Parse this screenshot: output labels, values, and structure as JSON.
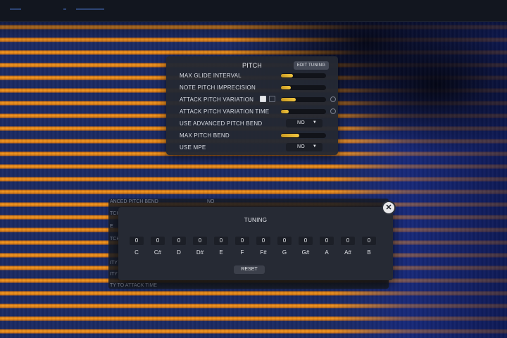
{
  "pitch_panel": {
    "title": "PITCH",
    "edit_tuning_label": "EDIT TUNING",
    "rows": [
      {
        "label": "MAX GLIDE INTERVAL",
        "type": "slider",
        "fill": 0.27
      },
      {
        "label": "NOTE PITCH IMPRECISION",
        "type": "slider",
        "fill": 0.22
      },
      {
        "label": "ATTACK PITCH VARIATION",
        "type": "slider",
        "fill": 0.33
      },
      {
        "label": "ATTACK PITCH VARIATION TIME",
        "type": "slider",
        "fill": 0.17
      },
      {
        "label": "USE ADVANCED PITCH BEND",
        "type": "dropdown",
        "value": "NO"
      },
      {
        "label": "MAX PITCH BEND",
        "type": "slider",
        "fill": 0.41
      },
      {
        "label": "USE MPE",
        "type": "dropdown",
        "value": "NO"
      }
    ]
  },
  "ghost_panel": {
    "line1": "ANCED PITCH BEND",
    "line1_value": "NO",
    "line2": "TCH",
    "line3": "E",
    "line4": "TCH",
    "line5": "ITY",
    "line6": "ITY",
    "line7": "TY TO ATTACK TIME"
  },
  "tuning": {
    "title": "TUNING",
    "notes": [
      {
        "name": "C",
        "value": "0"
      },
      {
        "name": "C#",
        "value": "0"
      },
      {
        "name": "D",
        "value": "0"
      },
      {
        "name": "D#",
        "value": "0"
      },
      {
        "name": "E",
        "value": "0"
      },
      {
        "name": "F",
        "value": "0"
      },
      {
        "name": "F#",
        "value": "0"
      },
      {
        "name": "G",
        "value": "0"
      },
      {
        "name": "G#",
        "value": "0"
      },
      {
        "name": "A",
        "value": "0"
      },
      {
        "name": "A#",
        "value": "0"
      },
      {
        "name": "B",
        "value": "0"
      }
    ],
    "reset_label": "RESET",
    "close_symbol": "✕"
  },
  "icons": {
    "close": "close-icon",
    "mod": "modulation-icon",
    "info": "info-circle-icon"
  }
}
